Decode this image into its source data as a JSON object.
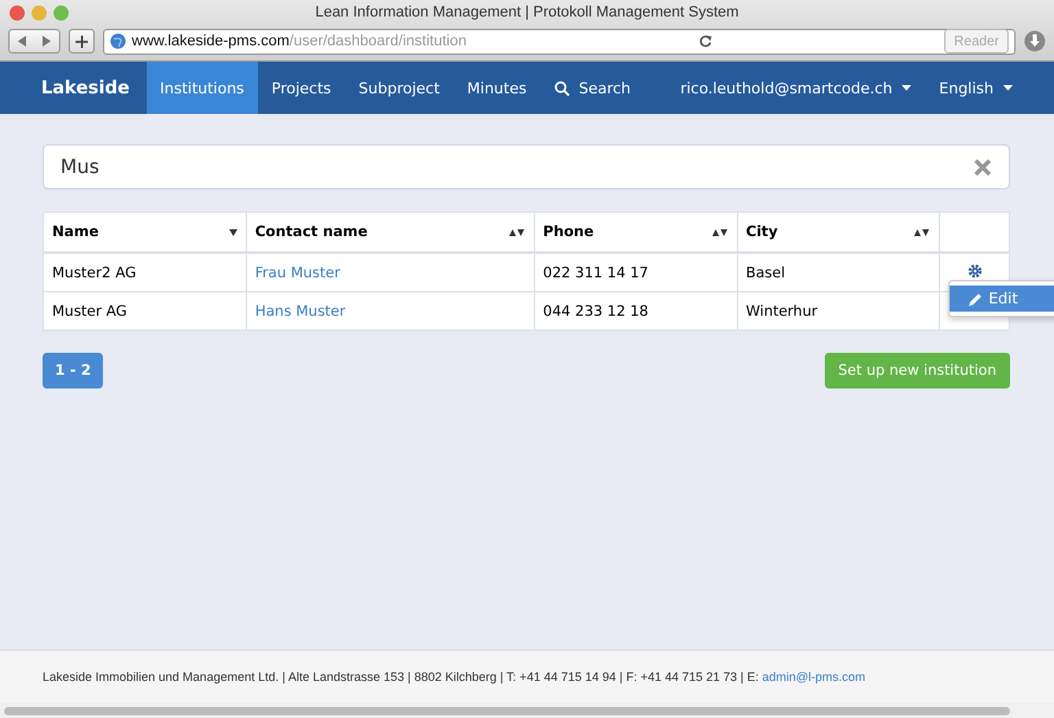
{
  "window": {
    "title": "Lean Information Management | Protokoll Management System"
  },
  "browser": {
    "url_host": "www.lakeside-pms.com",
    "url_path": "/user/dashboard/institution",
    "reader": "Reader"
  },
  "navbar": {
    "brand": "Lakeside",
    "items": [
      {
        "label": "Institutions",
        "selected": true,
        "kind": "link"
      },
      {
        "label": "Projects",
        "selected": false,
        "kind": "link"
      },
      {
        "label": "Subproject",
        "selected": false,
        "kind": "link"
      },
      {
        "label": "Minutes",
        "selected": false,
        "kind": "link"
      },
      {
        "label": "Search",
        "selected": false,
        "kind": "search"
      }
    ],
    "right": [
      {
        "label": "rico.leuthold@smartcode.ch"
      },
      {
        "label": "English"
      }
    ]
  },
  "search": {
    "value": "Mus"
  },
  "table": {
    "columns": [
      {
        "label": "Name",
        "kind": "sorted"
      },
      {
        "label": "Contact name",
        "kind": "sortable"
      },
      {
        "label": "Phone",
        "kind": "sortable"
      },
      {
        "label": "City",
        "kind": "sortable"
      }
    ],
    "rows": [
      {
        "name": "Muster2 AG",
        "contact": "Frau Muster",
        "phone": "022 311 14 17",
        "city": "Basel",
        "menu_open": true
      },
      {
        "name": "Muster AG",
        "contact": "Hans Muster",
        "phone": "044 233 12 18",
        "city": "Winterhur",
        "menu_open": false
      }
    ],
    "menu": {
      "items": [
        "Edit"
      ]
    }
  },
  "pagination": {
    "label": "1 - 2"
  },
  "new_button": "Set up new institution",
  "footer": {
    "text": "Lakeside Immobilien und Management Ltd. | Alte Landstrasse 153 | 8802 Kilchberg | T: +41 44 715 14 94 | F: +41 44 715 21 73 | E: ",
    "email": "admin@l-pms.com"
  }
}
